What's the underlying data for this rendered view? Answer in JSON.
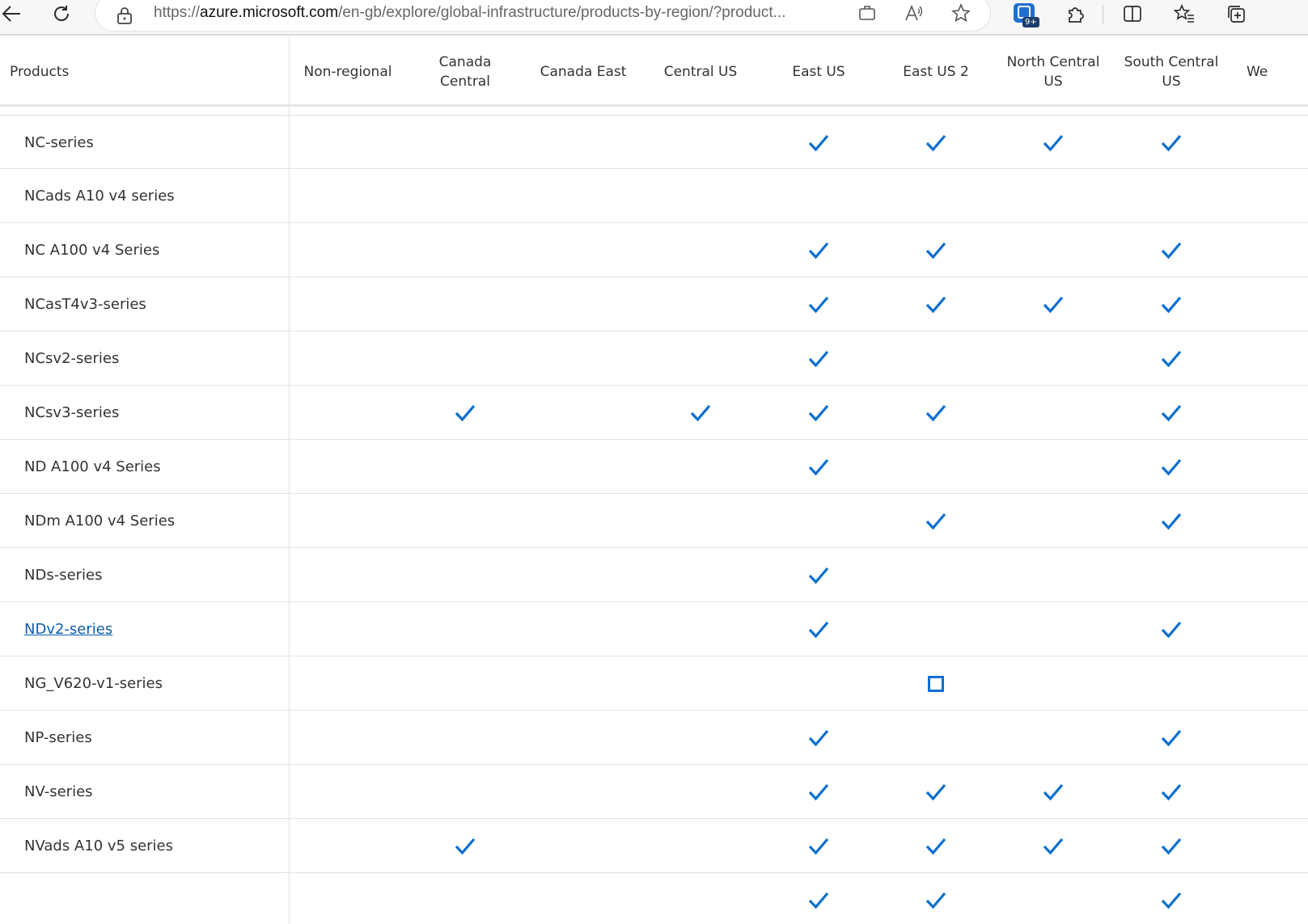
{
  "browser": {
    "url_prefix": "https://",
    "url_host": "azure.microsoft.com",
    "url_path": "/en-gb/explore/global-infrastructure/products-by-region/?product...",
    "extension_badge": "9+"
  },
  "table": {
    "header_products": "Products",
    "regions": [
      "Non-regional",
      "Canada Central",
      "Canada East",
      "Central US",
      "East US",
      "East US 2",
      "North Central US",
      "South Central US",
      "We"
    ],
    "rows": [
      {
        "name": "NC-series",
        "link": false,
        "cells": [
          "",
          "",
          "",
          "",
          "check",
          "check",
          "check",
          "check",
          ""
        ]
      },
      {
        "name": "NCads A10 v4 series",
        "link": false,
        "cells": [
          "",
          "",
          "",
          "",
          "",
          "",
          "",
          "",
          ""
        ]
      },
      {
        "name": "NC A100 v4 Series",
        "link": false,
        "cells": [
          "",
          "",
          "",
          "",
          "check",
          "check",
          "",
          "check",
          ""
        ]
      },
      {
        "name": "NCasT4v3-series",
        "link": false,
        "cells": [
          "",
          "",
          "",
          "",
          "check",
          "check",
          "check",
          "check",
          ""
        ]
      },
      {
        "name": "NCsv2-series",
        "link": false,
        "cells": [
          "",
          "",
          "",
          "",
          "check",
          "",
          "",
          "check",
          ""
        ]
      },
      {
        "name": "NCsv3-series",
        "link": false,
        "cells": [
          "",
          "check",
          "",
          "check",
          "check",
          "check",
          "",
          "check",
          ""
        ]
      },
      {
        "name": "ND A100 v4 Series",
        "link": false,
        "cells": [
          "",
          "",
          "",
          "",
          "check",
          "",
          "",
          "check",
          ""
        ]
      },
      {
        "name": "NDm A100 v4 Series",
        "link": false,
        "cells": [
          "",
          "",
          "",
          "",
          "",
          "check",
          "",
          "check",
          ""
        ]
      },
      {
        "name": "NDs-series",
        "link": false,
        "cells": [
          "",
          "",
          "",
          "",
          "check",
          "",
          "",
          "",
          ""
        ]
      },
      {
        "name": "NDv2-series",
        "link": true,
        "cells": [
          "",
          "",
          "",
          "",
          "check",
          "",
          "",
          "check",
          ""
        ]
      },
      {
        "name": "NG_V620-v1-series",
        "link": false,
        "cells": [
          "",
          "",
          "",
          "",
          "",
          "preview",
          "",
          "",
          ""
        ]
      },
      {
        "name": "NP-series",
        "link": false,
        "cells": [
          "",
          "",
          "",
          "",
          "check",
          "",
          "",
          "check",
          ""
        ]
      },
      {
        "name": "NV-series",
        "link": false,
        "cells": [
          "",
          "",
          "",
          "",
          "check",
          "check",
          "check",
          "check",
          ""
        ]
      },
      {
        "name": "NVads A10 v5 series",
        "link": false,
        "cells": [
          "",
          "check",
          "",
          "",
          "check",
          "check",
          "check",
          "check",
          ""
        ]
      },
      {
        "name": "",
        "link": false,
        "cells": [
          "",
          "",
          "",
          "",
          "check",
          "check",
          "",
          "check",
          ""
        ]
      }
    ]
  },
  "colors": {
    "accent": "#0b6fd1",
    "link": "#0b5cad"
  }
}
